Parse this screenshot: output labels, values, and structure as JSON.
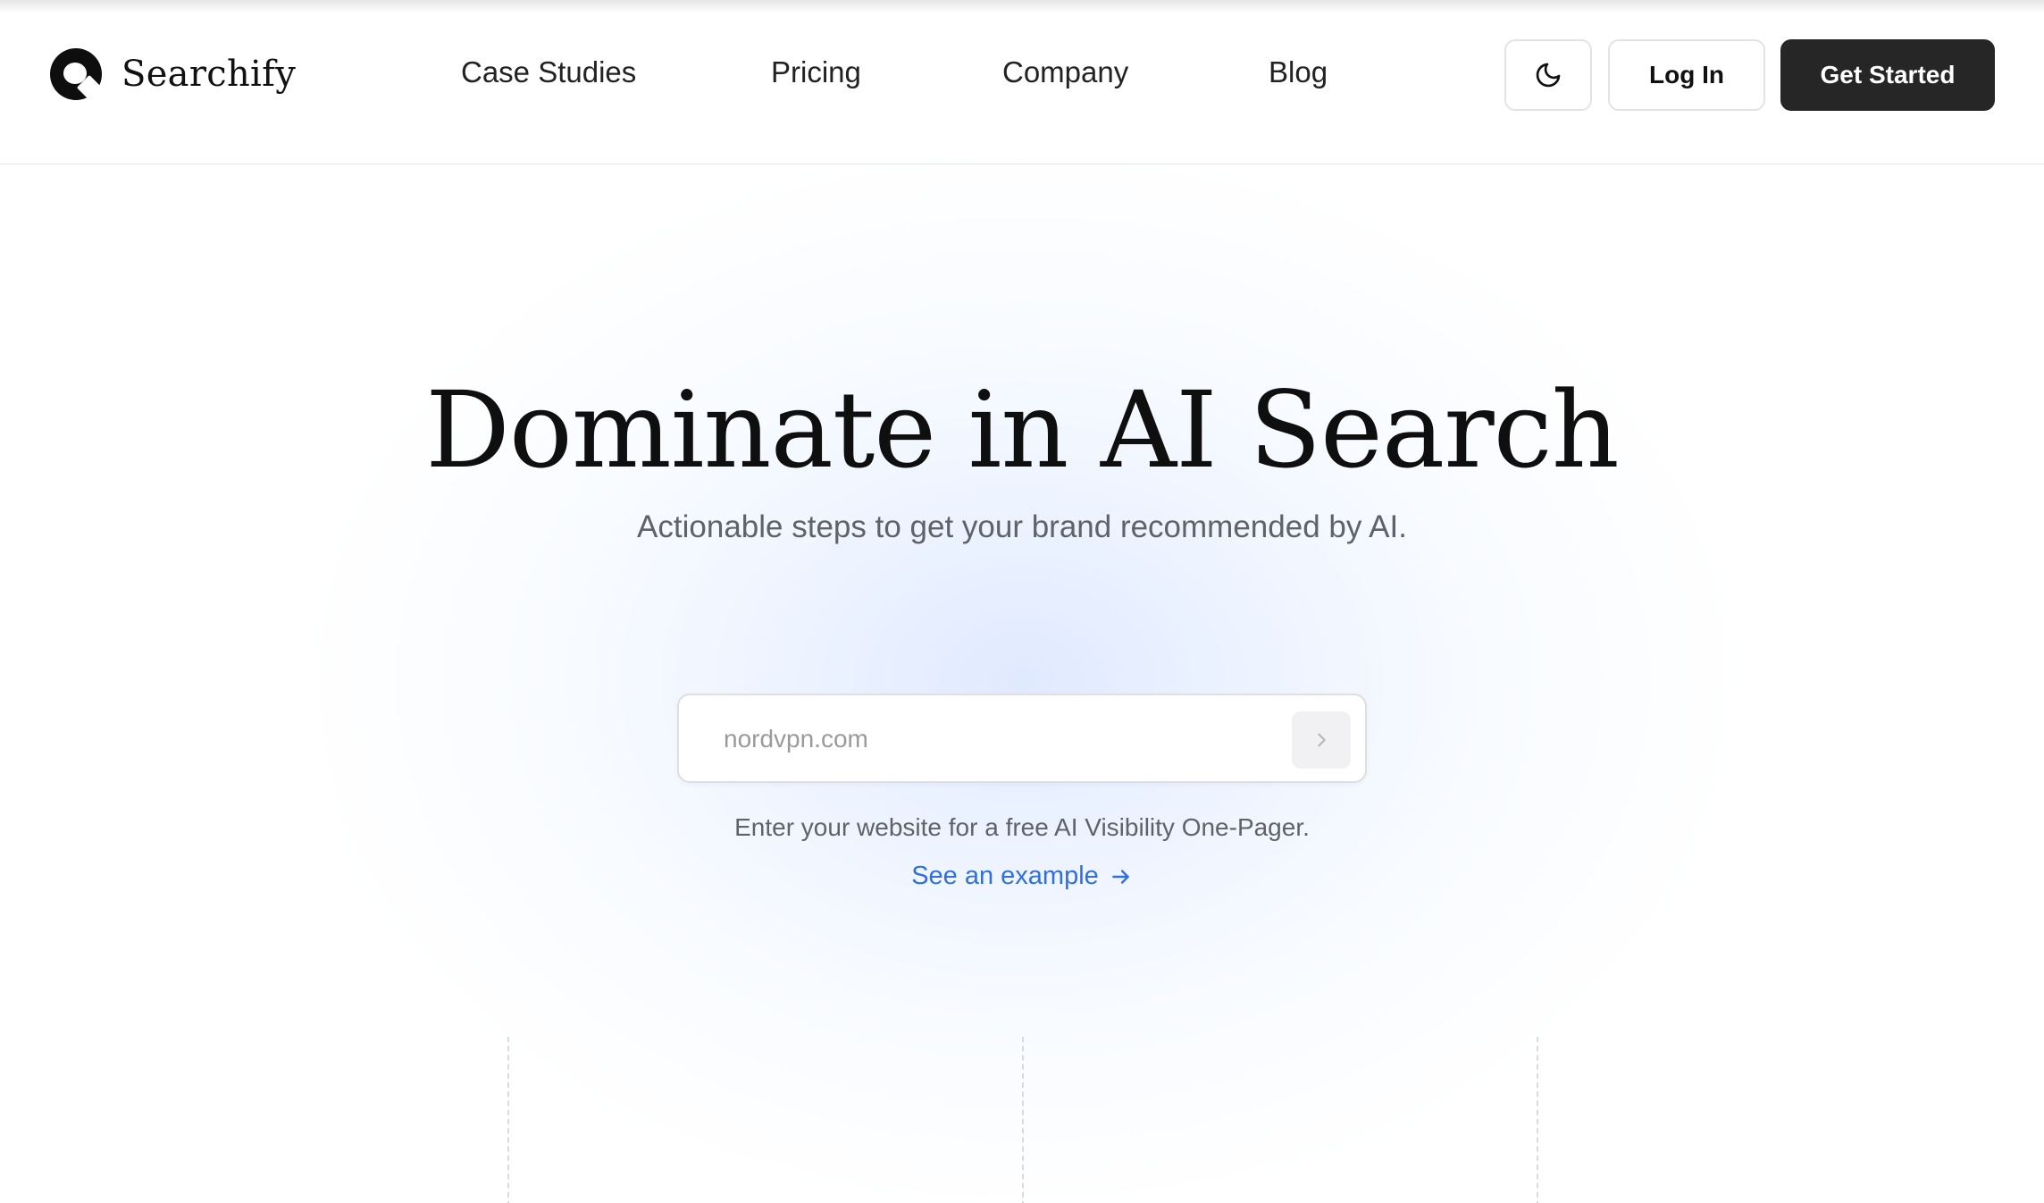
{
  "brand": {
    "name": "Searchify",
    "logo_icon": "searchify-logo-icon"
  },
  "nav": {
    "items": [
      {
        "label": "Case Studies"
      },
      {
        "label": "Pricing"
      },
      {
        "label": "Company"
      },
      {
        "label": "Blog"
      }
    ]
  },
  "actions": {
    "theme_icon": "moon-icon",
    "login_label": "Log In",
    "get_started_label": "Get Started"
  },
  "hero": {
    "title": "Dominate in AI Search",
    "subtitle": "Actionable steps to get your brand recommended by AI.",
    "search": {
      "placeholder": "nordvpn.com",
      "value": "",
      "submit_icon": "chevron-right-icon"
    },
    "helper_text": "Enter your website for a free AI Visibility One-Pager.",
    "example_link": "See an example",
    "example_icon": "arrow-right-icon"
  },
  "colors": {
    "accent_link": "#2f6fe0",
    "primary_button": "#262626",
    "glow": "#e6eeff"
  }
}
